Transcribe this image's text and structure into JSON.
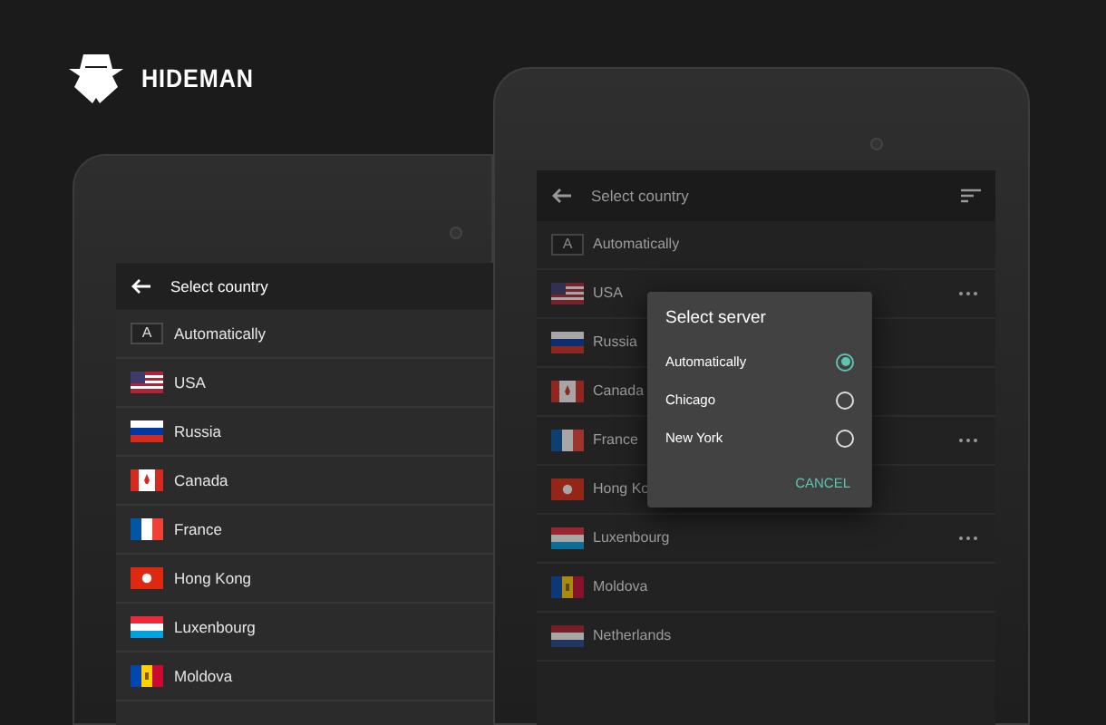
{
  "brand": {
    "name": "HIDEMAN"
  },
  "left_tablet": {
    "title": "Select country",
    "auto_badge": "A",
    "items": [
      {
        "name": "Automatically",
        "kind": "auto"
      },
      {
        "name": "USA",
        "kind": "us"
      },
      {
        "name": "Russia",
        "kind": "ru"
      },
      {
        "name": "Canada",
        "kind": "ca"
      },
      {
        "name": "France",
        "kind": "fr"
      },
      {
        "name": "Hong Kong",
        "kind": "hk"
      },
      {
        "name": "Luxenbourg",
        "kind": "lu"
      },
      {
        "name": "Moldova",
        "kind": "md"
      }
    ]
  },
  "right_tablet": {
    "title": "Select country",
    "auto_badge": "A",
    "items": [
      {
        "name": "Automatically",
        "kind": "auto",
        "more": false
      },
      {
        "name": "USA",
        "kind": "us",
        "more": true
      },
      {
        "name": "Russia",
        "kind": "ru",
        "more": false
      },
      {
        "name": "Canada",
        "kind": "ca",
        "more": false
      },
      {
        "name": "France",
        "kind": "fr",
        "more": true
      },
      {
        "name": "Hong Ko",
        "kind": "hk",
        "more": false
      },
      {
        "name": "Luxenbourg",
        "kind": "lu",
        "more": true
      },
      {
        "name": "Moldova",
        "kind": "md",
        "more": false
      },
      {
        "name": "Netherlands",
        "kind": "nl",
        "more": false
      }
    ],
    "dialog": {
      "title": "Select server",
      "options": [
        {
          "label": "Automatically",
          "selected": true
        },
        {
          "label": "Chicago",
          "selected": false
        },
        {
          "label": "New York",
          "selected": false
        }
      ],
      "cancel": "CANCEL"
    }
  }
}
